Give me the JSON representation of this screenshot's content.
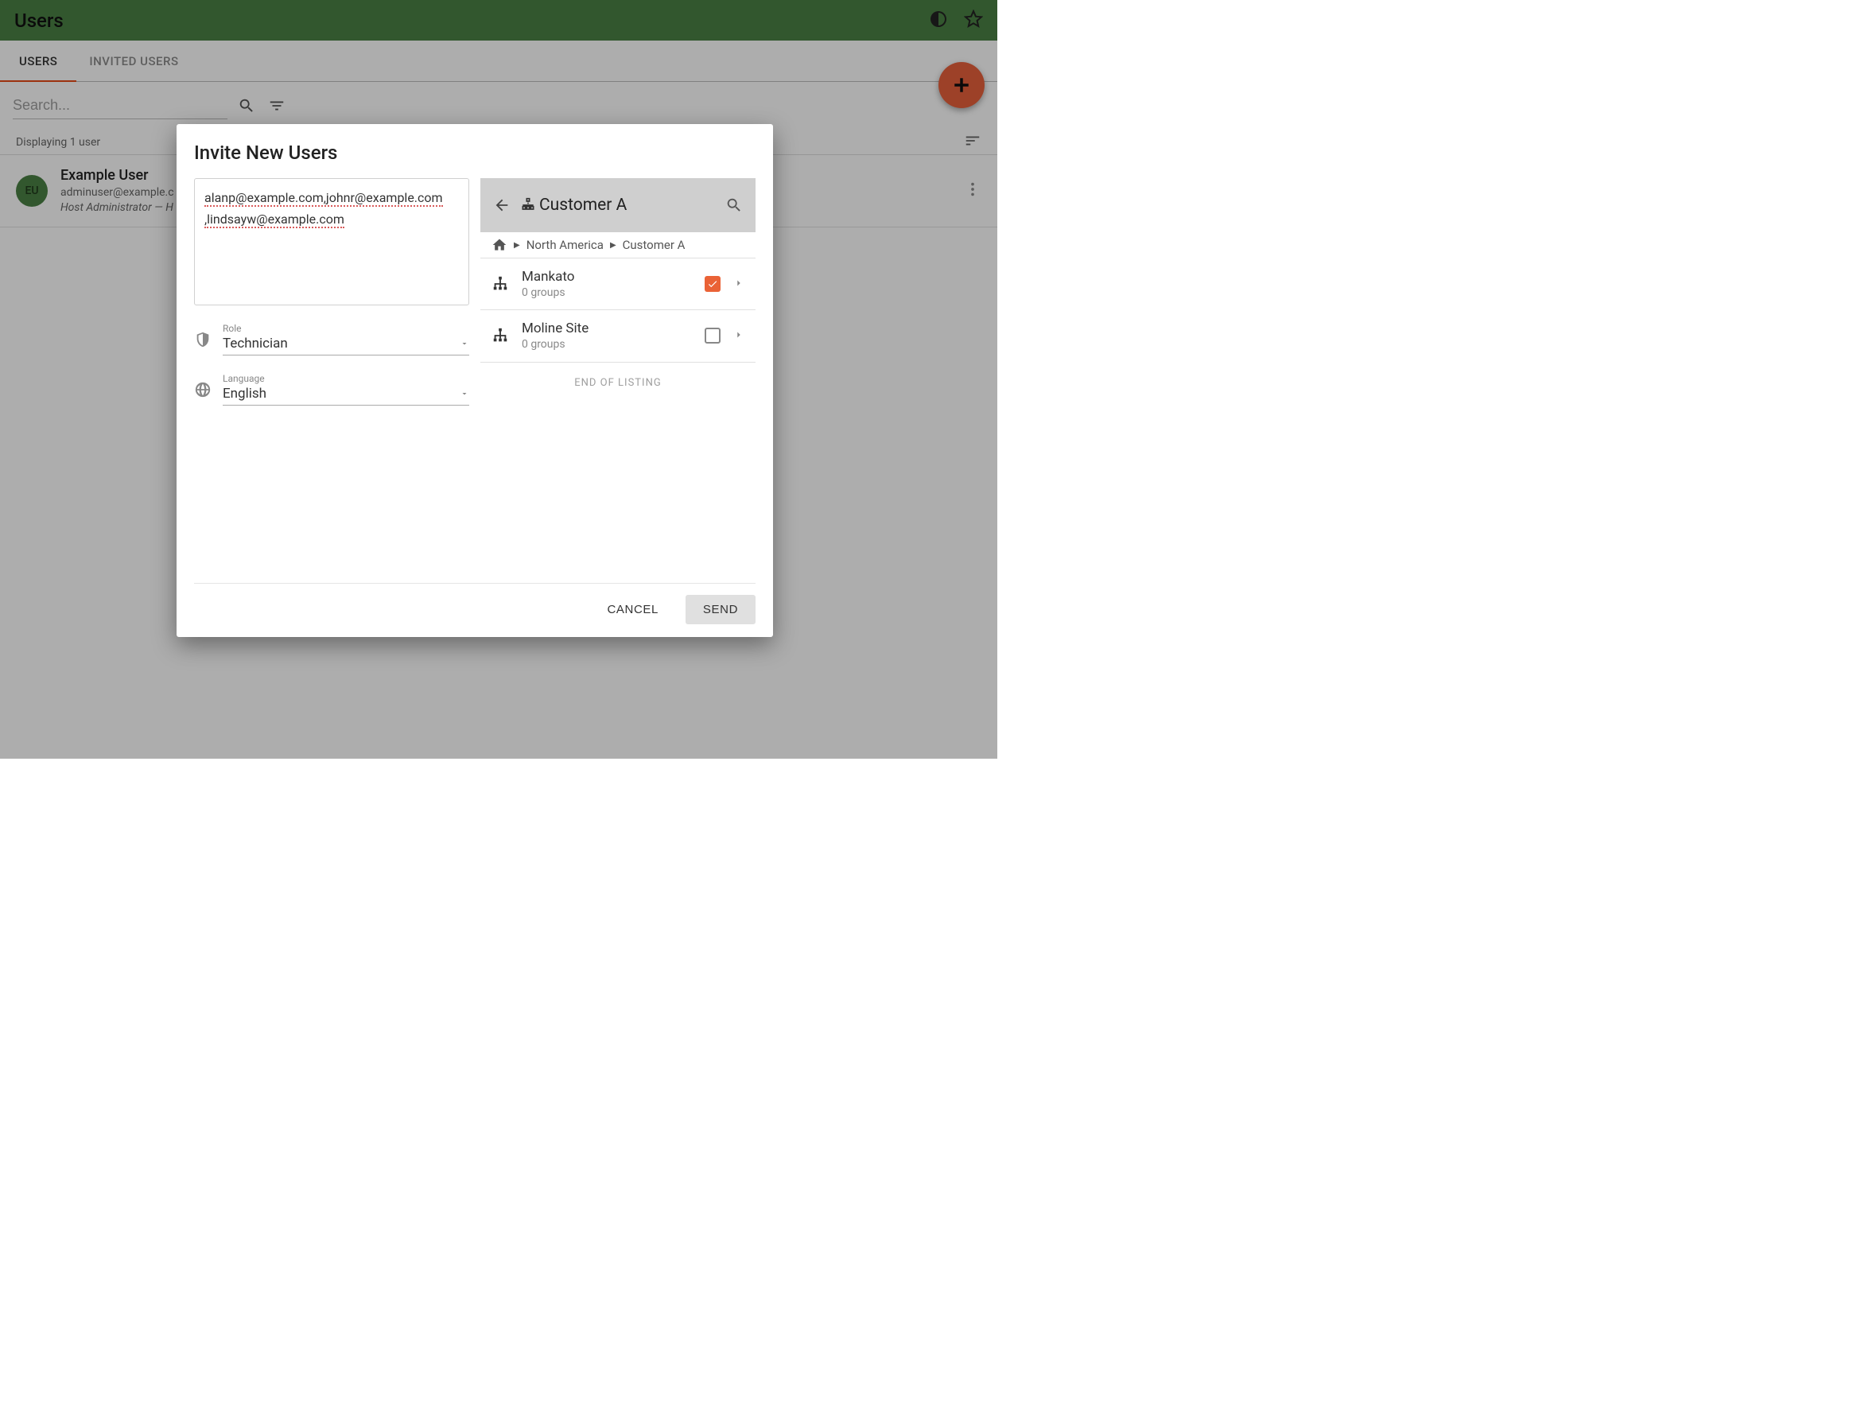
{
  "header": {
    "title": "Users"
  },
  "tabs": {
    "users": "USERS",
    "invited": "INVITED USERS"
  },
  "search": {
    "placeholder": "Search..."
  },
  "list": {
    "display_text": "Displaying 1 user",
    "user": {
      "initials": "EU",
      "name": "Example User",
      "email": "adminuser@example.c",
      "role_line": "Host Administrator — H"
    }
  },
  "modal": {
    "title": "Invite New Users",
    "emails_line1": "alanp@example.com,johnr@example.com",
    "emails_line2": ",lindsayw@example.com",
    "role": {
      "label": "Role",
      "value": "Technician"
    },
    "language": {
      "label": "Language",
      "value": "English"
    },
    "group_picker": {
      "current": "Customer A",
      "breadcrumb": {
        "level1": "North America",
        "level2": "Customer A"
      },
      "items": [
        {
          "name": "Mankato",
          "sub": "0 groups",
          "checked": true
        },
        {
          "name": "Moline Site",
          "sub": "0 groups",
          "checked": false
        }
      ],
      "end": "END OF LISTING"
    },
    "actions": {
      "cancel": "CANCEL",
      "send": "SEND"
    }
  }
}
